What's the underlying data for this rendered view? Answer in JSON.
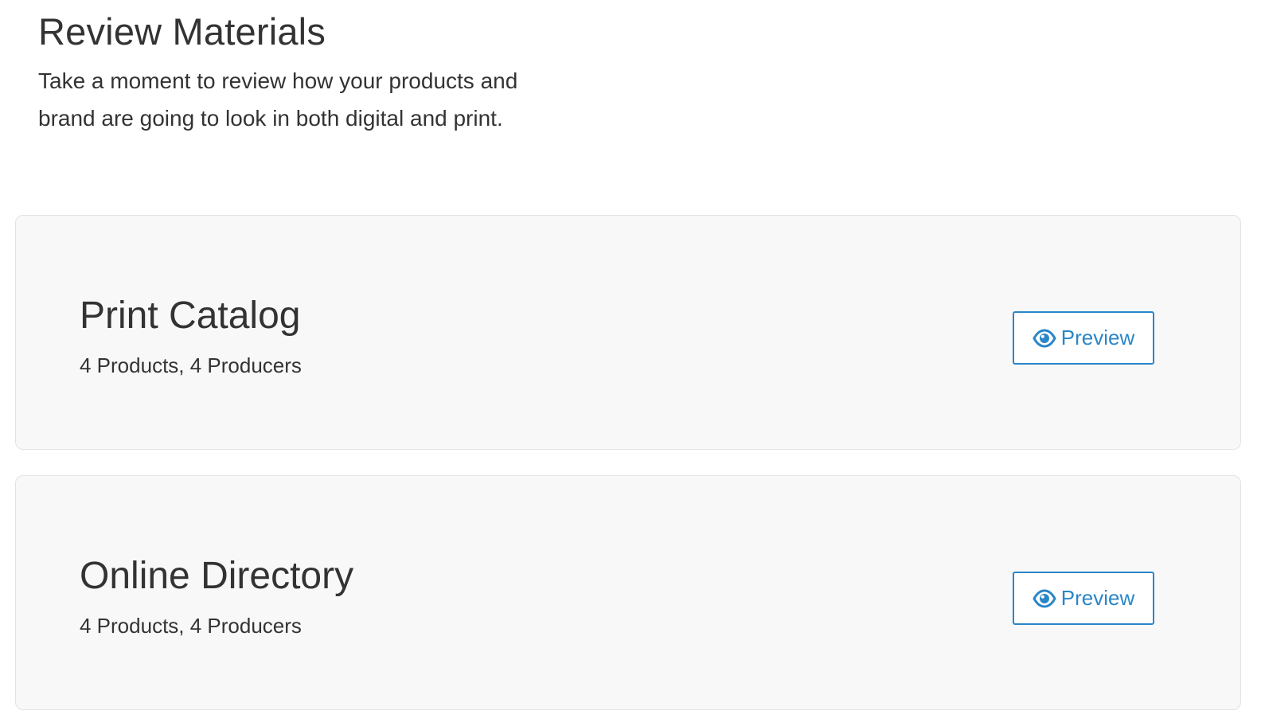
{
  "header": {
    "title": "Review Materials",
    "description": "Take a moment to review how your products and brand are going to look in both digital and print."
  },
  "materials": [
    {
      "title": "Print Catalog",
      "subtitle": "4 Products, 4 Producers",
      "button_label": "Preview",
      "button_icon": "eye-icon"
    },
    {
      "title": "Online Directory",
      "subtitle": "4 Products, 4 Producers",
      "button_label": "Preview",
      "button_icon": "eye-icon"
    }
  ],
  "colors": {
    "accent": "#2a86c8",
    "card_background": "#f8f8f8",
    "card_border": "#e3e3e3",
    "text": "#333333"
  }
}
